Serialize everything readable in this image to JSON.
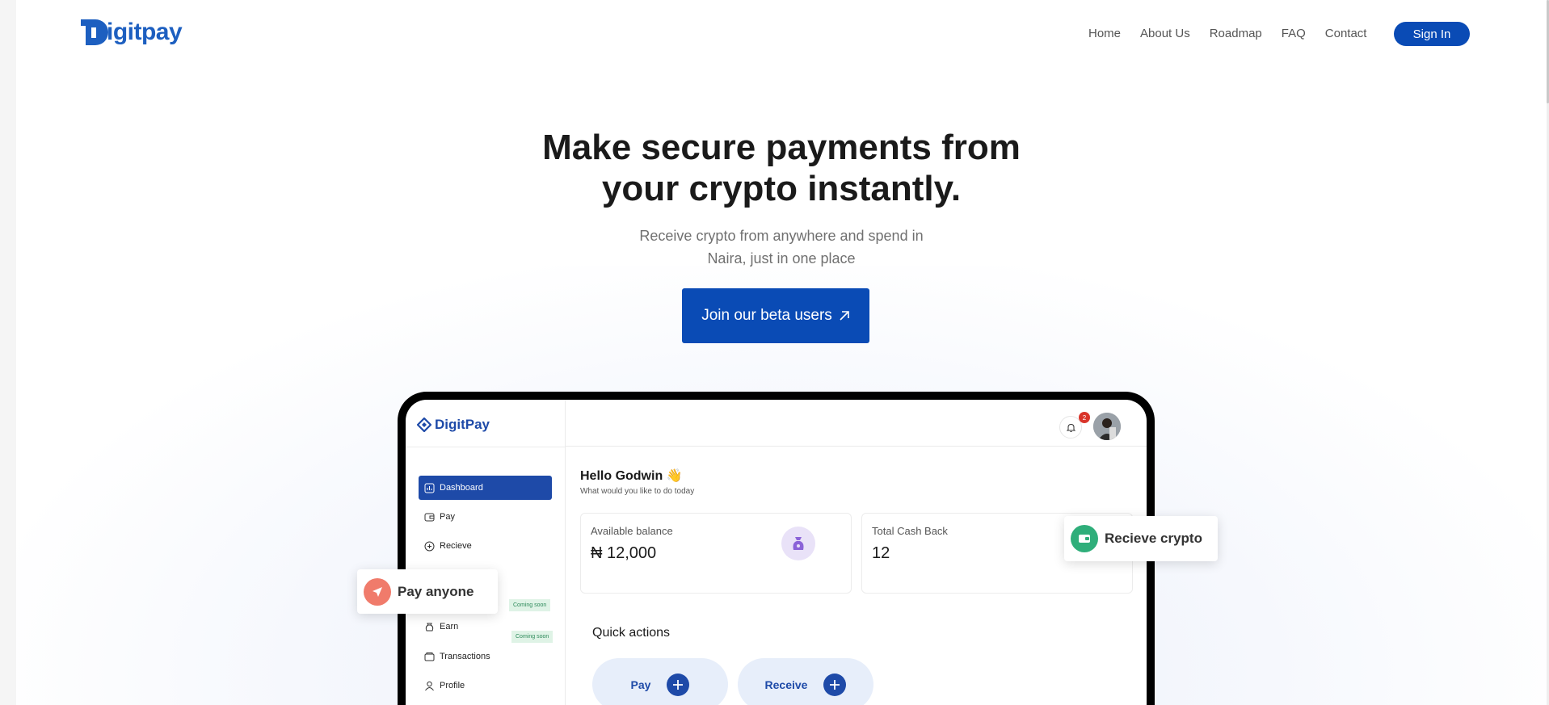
{
  "nav": {
    "logo_text": "igitpay",
    "items": [
      "Home",
      "About Us",
      "Roadmap",
      "FAQ",
      "Contact"
    ],
    "signin_label": "Sign In"
  },
  "hero": {
    "title_line1": "Make secure payments from",
    "title_line2": "your crypto instantly.",
    "subtitle_line1": "Receive crypto from anywhere and spend in",
    "subtitle_line2": "Naira, just in one place",
    "cta_label": "Join our beta users"
  },
  "app": {
    "logo_text": "DigitPay",
    "notification_count": "2",
    "sidebar": {
      "items": [
        {
          "label": "Dashboard"
        },
        {
          "label": "Pay"
        },
        {
          "label": "Recieve"
        },
        {
          "label": "Earn",
          "badge": "Coming soon"
        },
        {
          "label": "Transactions"
        },
        {
          "label": "Profile"
        }
      ],
      "hidden_badge": "Coming soon"
    },
    "greeting": "Hello Godwin",
    "greeting_emoji": "👋",
    "greeting_sub": "What would you like to do today",
    "cards": [
      {
        "label": "Available balance",
        "value": "₦ 12,000"
      },
      {
        "label": "Total Cash Back",
        "value": "12"
      }
    ],
    "quick_actions_title": "Quick actions",
    "quick_actions": [
      "Pay",
      "Receive"
    ]
  },
  "floating": {
    "pay_anyone": "Pay anyone",
    "recieve_crypto": "Recieve crypto"
  },
  "colors": {
    "brand": "#0a4bb5",
    "app_accent": "#1e4aa8",
    "pay_badge": "#f07b6b",
    "receive_badge": "#2fae7a"
  }
}
